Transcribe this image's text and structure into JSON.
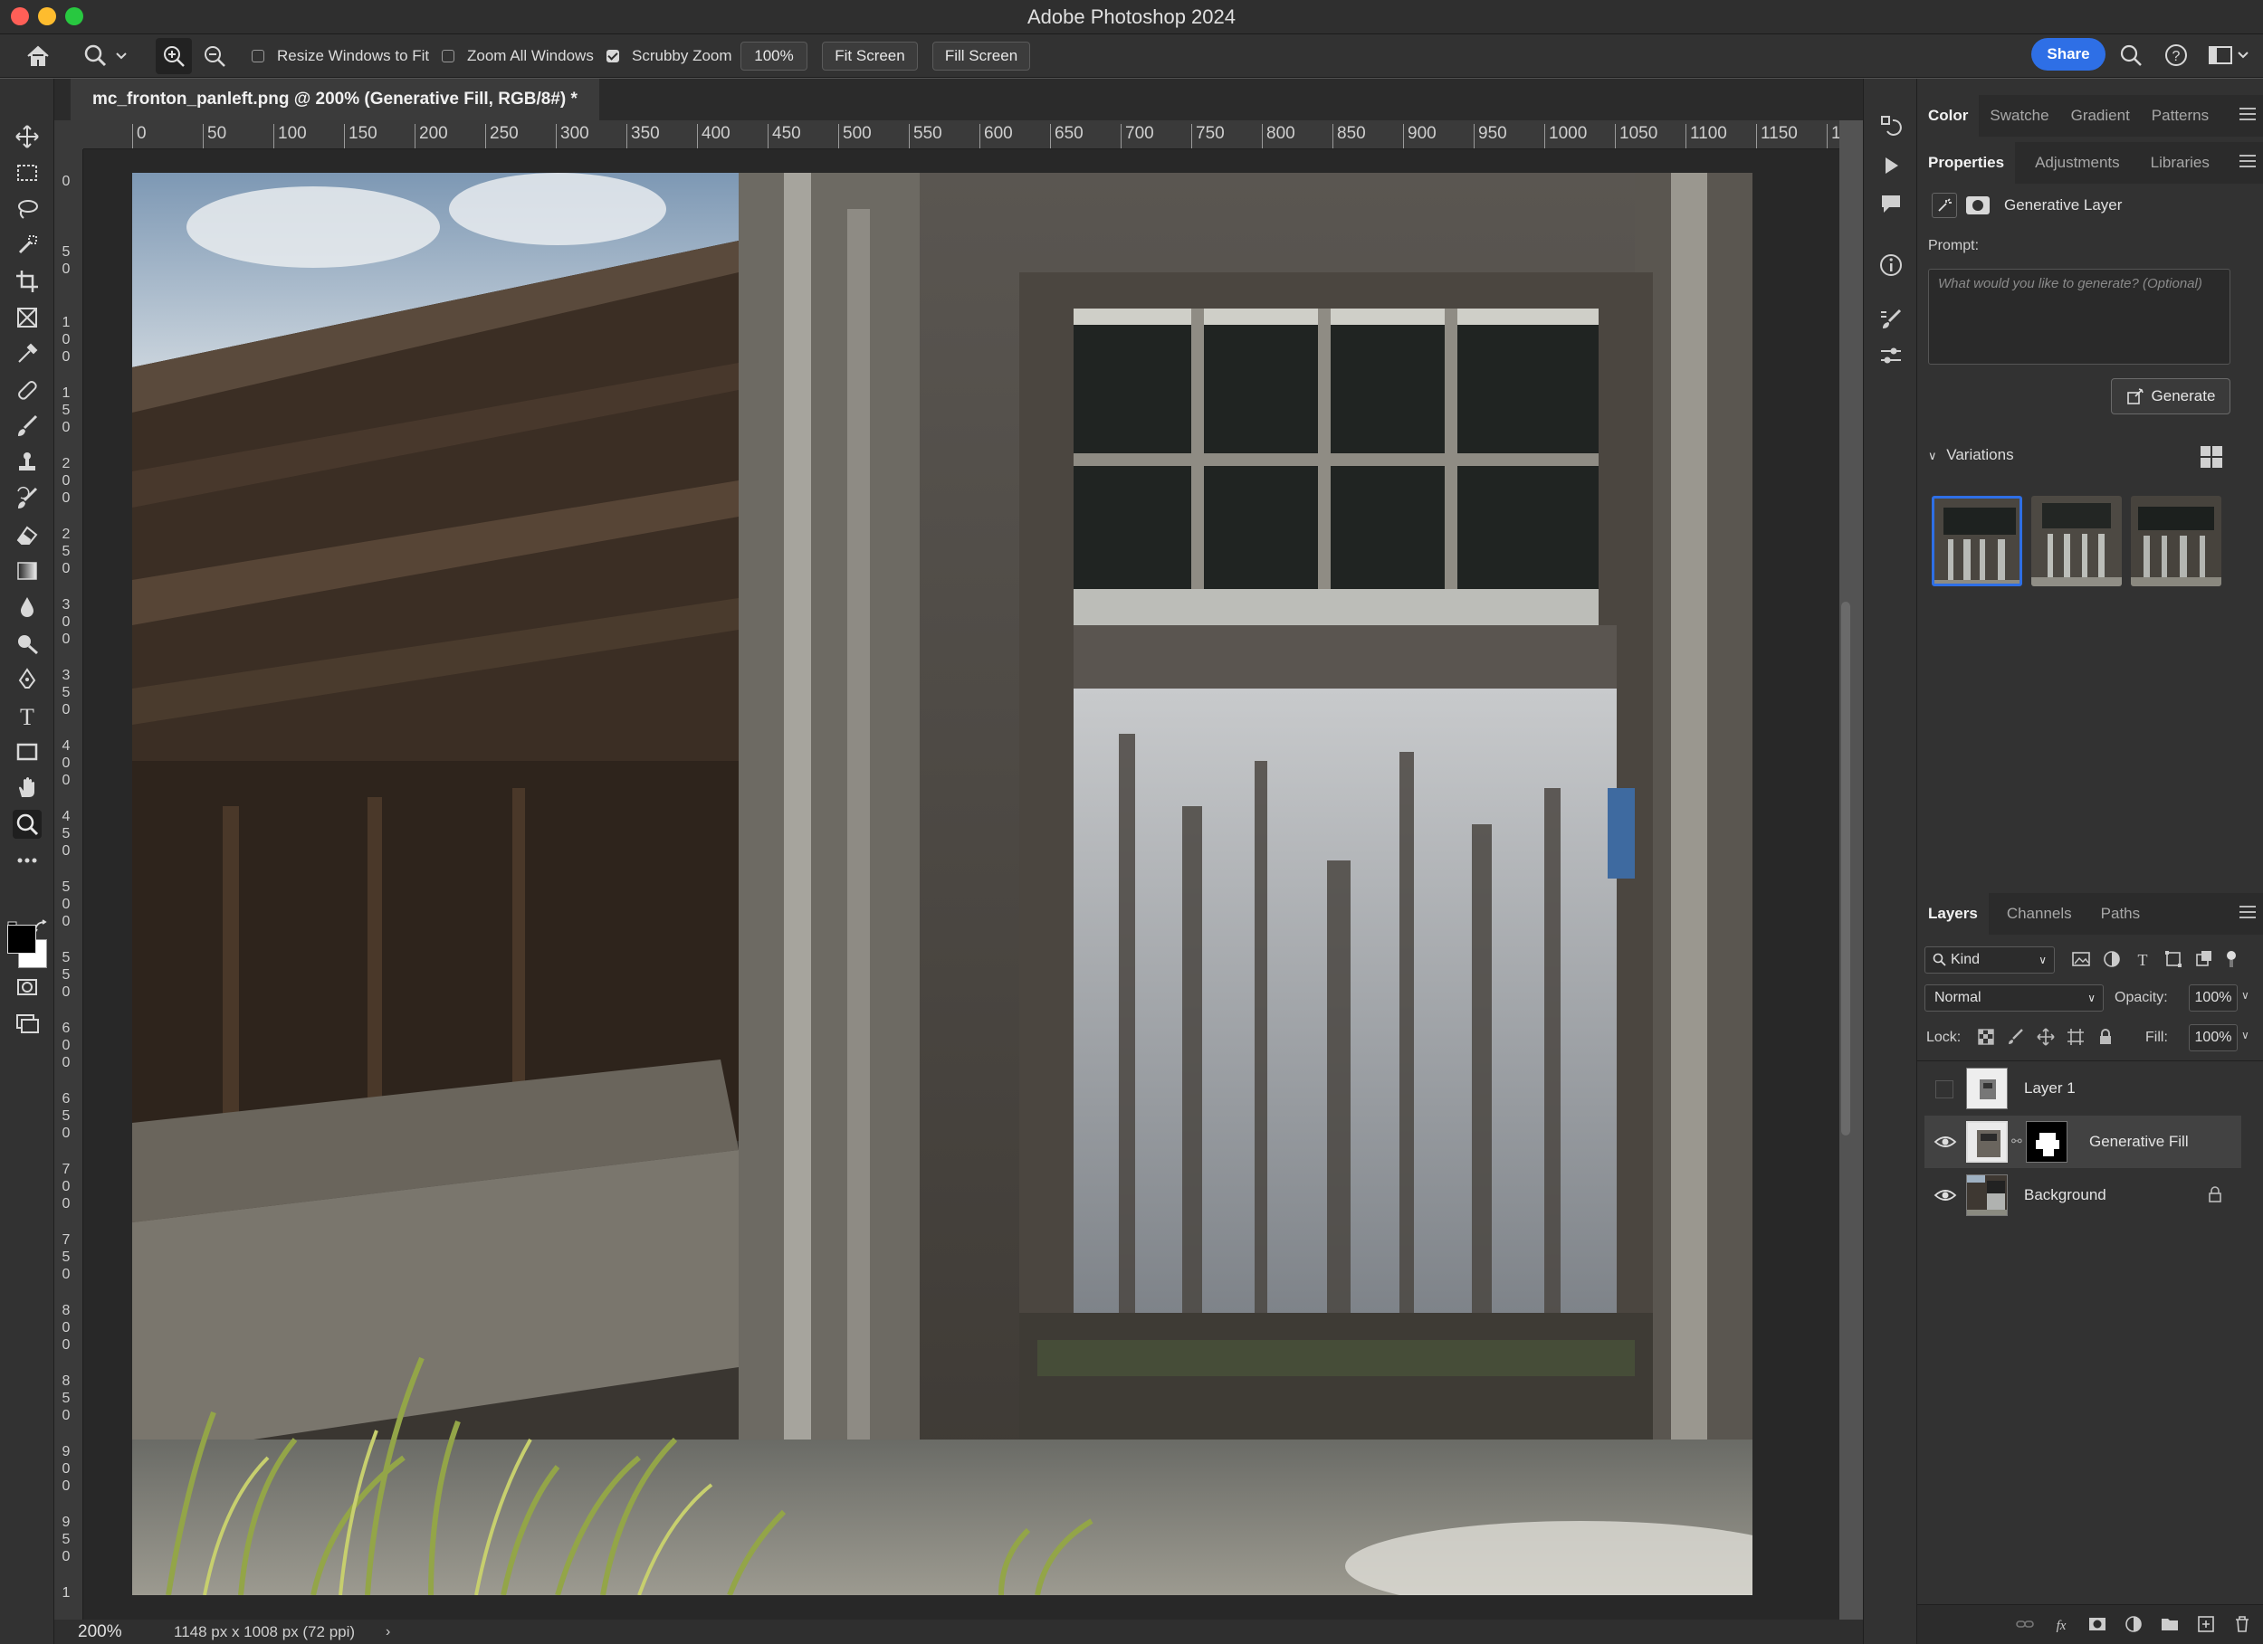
{
  "window": {
    "title": "Adobe Photoshop 2024"
  },
  "options": {
    "resize_windows": "Resize Windows to Fit",
    "zoom_all": "Zoom All Windows",
    "scrubby": "Scrubby Zoom",
    "zoom_value": "100%",
    "fit_screen": "Fit Screen",
    "fill_screen": "Fill Screen",
    "share": "Share",
    "resize_checked": false,
    "zoom_all_checked": false,
    "scrubby_checked": true
  },
  "document": {
    "tab_title": "mc_fronton_panleft.png @ 200% (Generative Fill, RGB/8#) *",
    "zoom": "200%",
    "dimensions": "1148 px x 1008 px (72 ppi)"
  },
  "ruler": {
    "top": [
      "0",
      "50",
      "100",
      "150",
      "200",
      "250",
      "300",
      "350",
      "400",
      "450",
      "500",
      "550",
      "600",
      "650",
      "700",
      "750",
      "800",
      "850",
      "900",
      "950",
      "1000",
      "1050",
      "1100",
      "1150",
      "1"
    ],
    "left": [
      "0",
      "50",
      "100",
      "150",
      "200",
      "250",
      "300",
      "350",
      "400",
      "450",
      "500",
      "550",
      "600",
      "650",
      "700",
      "750",
      "800",
      "850",
      "900",
      "950",
      "1"
    ]
  },
  "panel_top": {
    "tabs": [
      "Color",
      "Swatche",
      "Gradient",
      "Patterns"
    ]
  },
  "properties": {
    "tabs": [
      "Properties",
      "Adjustments",
      "Libraries"
    ],
    "layer_type": "Generative Layer",
    "prompt_label": "Prompt:",
    "prompt_placeholder": "What would you like to generate? (Optional)",
    "generate": "Generate",
    "variations": "Variations"
  },
  "layers": {
    "tabs": [
      "Layers",
      "Channels",
      "Paths"
    ],
    "kind": "Kind",
    "blend": "Normal",
    "opacity_label": "Opacity:",
    "opacity": "100%",
    "lock_label": "Lock:",
    "fill_label": "Fill:",
    "fill": "100%",
    "items": [
      {
        "name": "Layer 1",
        "visible": false
      },
      {
        "name": "Generative Fill",
        "visible": true
      },
      {
        "name": "Background",
        "visible": true
      }
    ]
  }
}
